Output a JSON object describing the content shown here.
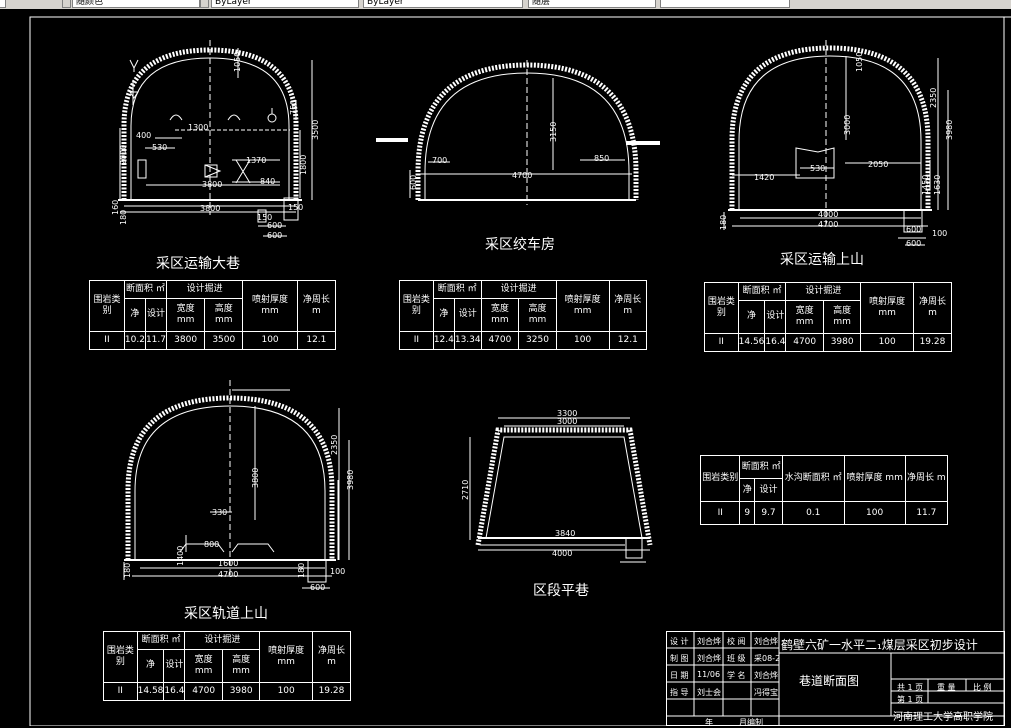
{
  "toolbar": {
    "items": [
      "ByLayer",
      "ByLayer",
      "随层",
      "随颜色"
    ]
  },
  "colors": {
    "background": "#000000",
    "line": "#ffffff",
    "toolbar": "#d6d3ce"
  },
  "drawings": [
    {
      "id": "d1",
      "title": "采区运输大巷",
      "dims": [
        "1050",
        "1300",
        "400",
        "530",
        "2000",
        "1370",
        "3500",
        "1800",
        "750",
        "3800",
        "840",
        "3800",
        "160",
        "180",
        "150",
        "600",
        "600",
        "150"
      ]
    },
    {
      "id": "d2",
      "title": "采区绞车房",
      "dims": [
        "3150",
        "700",
        "850",
        "4700",
        "600"
      ]
    },
    {
      "id": "d3",
      "title": "采区运输上山",
      "dims": [
        "1050",
        "3000",
        "2350",
        "3980",
        "1420",
        "530",
        "2050",
        "1450",
        "1630",
        "4000",
        "4700",
        "180",
        "600",
        "600",
        "100"
      ]
    },
    {
      "id": "d4",
      "title": "采区轨道上山",
      "dims": [
        "3800",
        "2350",
        "3980",
        "330",
        "800",
        "1400",
        "1600",
        "4700",
        "180",
        "180",
        "600",
        "100"
      ]
    },
    {
      "id": "d5",
      "title": "区段平巷",
      "dims": [
        "3300",
        "3000",
        "2710",
        "3840",
        "4000"
      ]
    }
  ],
  "tables": [
    {
      "id": "t1",
      "header": {
        "rock": "围岩类别",
        "area": "断面积 ㎡",
        "design": "设计掘进",
        "net": "净",
        "design_col": "设计",
        "width": "宽度 mm",
        "height": "高度 mm",
        "spray": "喷射厚度 mm",
        "perimeter": "净周长 m"
      },
      "row": {
        "rock": "II",
        "net": "10.2",
        "design": "11.7",
        "width": "3800",
        "height": "3500",
        "spray": "100",
        "perimeter": "12.1"
      }
    },
    {
      "id": "t2",
      "header": {
        "rock": "围岩类别",
        "area": "断面积 ㎡",
        "design": "设计掘进",
        "net": "净",
        "design_col": "设计",
        "width": "宽度 mm",
        "height": "高度 mm",
        "spray": "喷射厚度 mm",
        "perimeter": "净周长 m"
      },
      "row": {
        "rock": "II",
        "net": "12.4",
        "design": "13.34",
        "width": "4700",
        "height": "3250",
        "spray": "100",
        "perimeter": "12.1"
      }
    },
    {
      "id": "t3",
      "header": {
        "rock": "围岩类别",
        "area": "断面积 ㎡",
        "design": "设计掘进",
        "net": "净",
        "design_col": "设计",
        "width": "宽度 mm",
        "height": "高度 mm",
        "spray": "喷射厚度 mm",
        "perimeter": "净周长 m"
      },
      "row": {
        "rock": "II",
        "net": "14.56",
        "design": "16.4",
        "width": "4700",
        "height": "3980",
        "spray": "100",
        "perimeter": "19.28"
      }
    },
    {
      "id": "t4",
      "header": {
        "rock": "围岩类别",
        "area": "断面积 ㎡",
        "design": "设计掘进",
        "net": "净",
        "design_col": "设计",
        "width": "宽度 mm",
        "height": "高度 mm",
        "spray": "喷射厚度 mm",
        "perimeter": "净周长 m"
      },
      "row": {
        "rock": "II",
        "net": "14.58",
        "design": "16.4",
        "width": "4700",
        "height": "3980",
        "spray": "100",
        "perimeter": "19.28"
      }
    },
    {
      "id": "t5",
      "header": {
        "rock": "围岩类别",
        "area": "断面积 ㎡",
        "net": "净",
        "design_col": "设计",
        "ditch": "水沟断面积 ㎡",
        "spray": "喷射厚度 mm",
        "perimeter": "净周长 m"
      },
      "row": {
        "rock": "II",
        "net": "9",
        "design": "9.7",
        "ditch": "0.1",
        "spray": "100",
        "perimeter": "11.7"
      }
    }
  ],
  "title_block": {
    "project": "鹤壁六矿一水平二₁煤层采区初步设计",
    "drawing_name": "巷道断面图",
    "school": "河南理工大学高职学院",
    "rows": [
      [
        "设 计",
        "刘合烨",
        "校 阅",
        "刘合烨"
      ],
      [
        "制 图",
        "刘合烨",
        "班 级",
        "采08-2"
      ],
      [
        "日 期",
        "11/06",
        "学 名",
        "刘合烨"
      ],
      [
        "指 导",
        "刘士会",
        "",
        "冯得宝"
      ]
    ],
    "sheet": [
      "共 1 页",
      "重 量",
      "比 例"
    ],
    "page": "第 1 页",
    "footer": [
      "年",
      "月编制"
    ]
  }
}
